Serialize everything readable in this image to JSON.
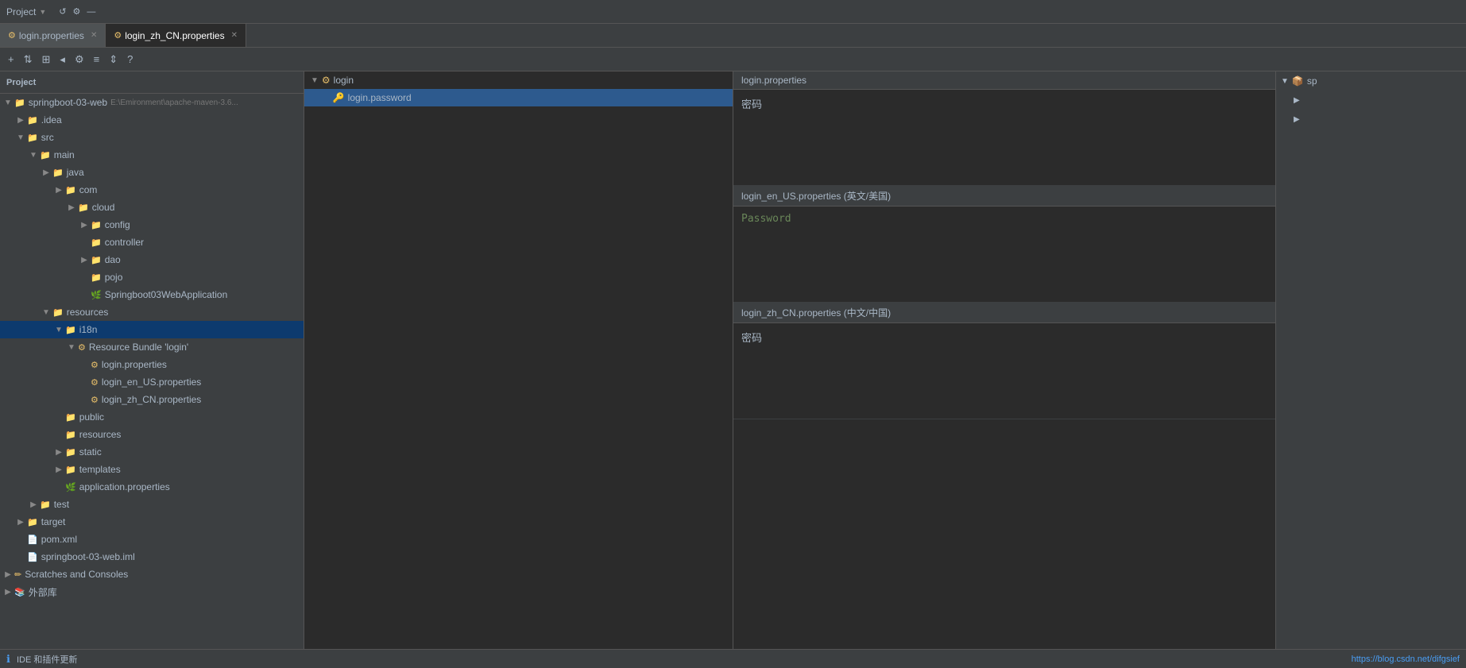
{
  "header": {
    "project_label": "Project",
    "project_path": "E:\\Emironment\\apache-maven-3.6..."
  },
  "tabs": [
    {
      "id": "tab-login-props",
      "label": "login.properties",
      "active": false,
      "icon": "📄"
    },
    {
      "id": "tab-login-zh",
      "label": "login_zh_CN.properties",
      "active": true,
      "icon": "📄"
    }
  ],
  "toolbar": {
    "buttons": [
      "+",
      "⇅",
      "⊞",
      "◂",
      "⚙",
      "≡",
      "⇕",
      "?"
    ]
  },
  "project_tree": {
    "items": [
      {
        "id": "springboot-03-web",
        "label": "springboot-03-web",
        "indent": 0,
        "type": "project",
        "arrow": "▼",
        "icon": "folder",
        "selected": false
      },
      {
        "id": "idea",
        "label": ".idea",
        "indent": 1,
        "type": "folder",
        "arrow": "▶",
        "icon": "folder"
      },
      {
        "id": "src",
        "label": "src",
        "indent": 1,
        "type": "folder",
        "arrow": "▼",
        "icon": "folder"
      },
      {
        "id": "main",
        "label": "main",
        "indent": 2,
        "type": "folder",
        "arrow": "▼",
        "icon": "folder"
      },
      {
        "id": "java",
        "label": "java",
        "indent": 3,
        "type": "folder",
        "arrow": "▶",
        "icon": "folder-src"
      },
      {
        "id": "com",
        "label": "com",
        "indent": 4,
        "type": "folder",
        "arrow": "▶",
        "icon": "folder"
      },
      {
        "id": "cloud",
        "label": "cloud",
        "indent": 5,
        "type": "folder",
        "arrow": "▶",
        "icon": "folder"
      },
      {
        "id": "config",
        "label": "config",
        "indent": 6,
        "type": "folder",
        "arrow": "▶",
        "icon": "folder"
      },
      {
        "id": "controller",
        "label": "controller",
        "indent": 6,
        "type": "folder",
        "arrow": "",
        "icon": "folder"
      },
      {
        "id": "dao",
        "label": "dao",
        "indent": 6,
        "type": "folder",
        "arrow": "▶",
        "icon": "folder"
      },
      {
        "id": "pojo",
        "label": "pojo",
        "indent": 6,
        "type": "folder",
        "arrow": "",
        "icon": "folder"
      },
      {
        "id": "springboot03",
        "label": "Springboot03WebApplication",
        "indent": 6,
        "type": "java",
        "arrow": "",
        "icon": "spring"
      },
      {
        "id": "resources",
        "label": "resources",
        "indent": 3,
        "type": "folder",
        "arrow": "▼",
        "icon": "folder-res"
      },
      {
        "id": "i18n",
        "label": "i18n",
        "indent": 4,
        "type": "folder",
        "arrow": "▼",
        "icon": "folder",
        "selected": true
      },
      {
        "id": "resource-bundle",
        "label": "Resource Bundle 'login'",
        "indent": 5,
        "type": "bundle",
        "arrow": "▼",
        "icon": "bundle"
      },
      {
        "id": "login-props",
        "label": "login.properties",
        "indent": 6,
        "type": "prop",
        "arrow": "",
        "icon": "prop"
      },
      {
        "id": "login-en",
        "label": "login_en_US.properties",
        "indent": 6,
        "type": "prop",
        "arrow": "",
        "icon": "prop"
      },
      {
        "id": "login-zh",
        "label": "login_zh_CN.properties",
        "indent": 6,
        "type": "prop",
        "arrow": "",
        "icon": "prop"
      },
      {
        "id": "public",
        "label": "public",
        "indent": 4,
        "type": "folder",
        "arrow": "",
        "icon": "folder"
      },
      {
        "id": "resources2",
        "label": "resources",
        "indent": 4,
        "type": "folder",
        "arrow": "",
        "icon": "folder"
      },
      {
        "id": "static",
        "label": "static",
        "indent": 4,
        "type": "folder",
        "arrow": "▶",
        "icon": "folder"
      },
      {
        "id": "templates",
        "label": "templates",
        "indent": 4,
        "type": "folder",
        "arrow": "▶",
        "icon": "folder"
      },
      {
        "id": "app-props",
        "label": "application.properties",
        "indent": 4,
        "type": "prop",
        "arrow": "",
        "icon": "spring-prop"
      },
      {
        "id": "test",
        "label": "test",
        "indent": 2,
        "type": "folder",
        "arrow": "▶",
        "icon": "folder"
      },
      {
        "id": "target",
        "label": "target",
        "indent": 1,
        "type": "folder",
        "arrow": "▶",
        "icon": "folder-target"
      },
      {
        "id": "pom",
        "label": "pom.xml",
        "indent": 1,
        "type": "xml",
        "arrow": "",
        "icon": "xml"
      },
      {
        "id": "iml",
        "label": "springboot-03-web.iml",
        "indent": 1,
        "type": "iml",
        "arrow": "",
        "icon": "iml"
      },
      {
        "id": "scratches",
        "label": "Scratches and Consoles",
        "indent": 0,
        "type": "scratch",
        "arrow": "▶",
        "icon": "scratch"
      },
      {
        "id": "external-libs",
        "label": "外部库",
        "indent": 0,
        "type": "lib",
        "arrow": "▶",
        "icon": "lib"
      }
    ]
  },
  "bundle_tree": {
    "items": [
      {
        "id": "bundle-login",
        "label": "login",
        "arrow": "▼",
        "icon": "bundle",
        "indent": 0
      },
      {
        "id": "bundle-password",
        "label": "login.password",
        "arrow": "",
        "icon": "key",
        "indent": 1,
        "selected": true
      }
    ]
  },
  "properties_panels": [
    {
      "id": "panel-default",
      "header": "login.properties",
      "value": "密码",
      "value_type": "zh"
    },
    {
      "id": "panel-en",
      "header": "login_en_US.properties (英文/美国)",
      "value": "Password",
      "value_type": "en"
    },
    {
      "id": "panel-zh",
      "header": "login_zh_CN.properties (中文/中国)",
      "value": "密码",
      "value_type": "zh"
    }
  ],
  "right_panel": {
    "items": [
      {
        "id": "rp-sp",
        "label": "sp",
        "icon": "📦",
        "arrow": "▼"
      },
      {
        "id": "rp-item1",
        "label": "",
        "icon": "▶",
        "indent": 1
      },
      {
        "id": "rp-item2",
        "label": "",
        "icon": "▶",
        "indent": 1
      }
    ]
  },
  "status_bar": {
    "info_text": "IDE 和插件更新",
    "link_text": "https://blog.csdn.net/difgsief"
  }
}
